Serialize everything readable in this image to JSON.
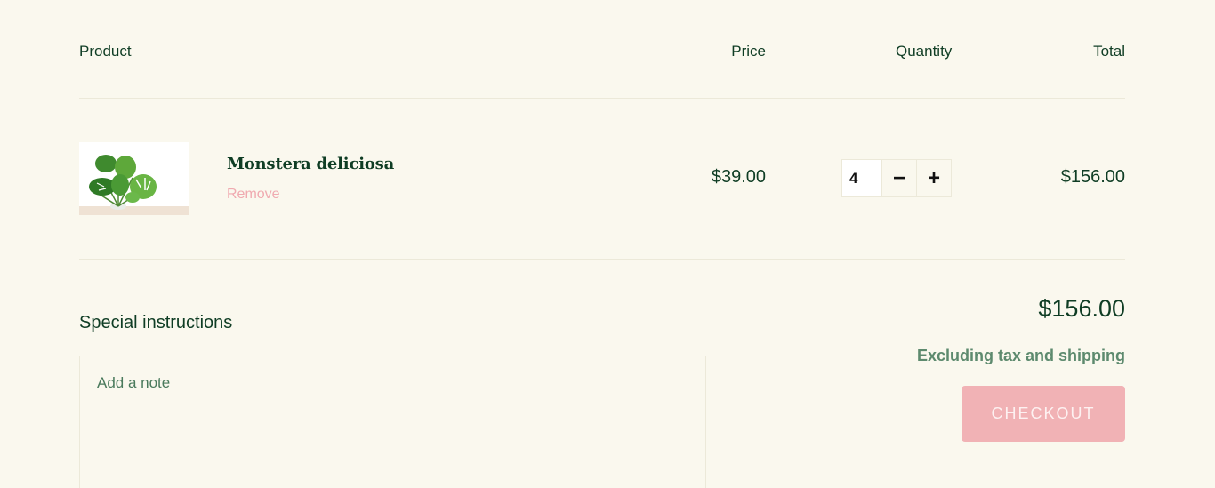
{
  "header": {
    "product": "Product",
    "price": "Price",
    "quantity": "Quantity",
    "total": "Total"
  },
  "item": {
    "name": "Monstera deliciosa",
    "remove_label": "Remove",
    "price": "$39.00",
    "quantity": "4",
    "decrement_symbol": "−",
    "increment_symbol": "+",
    "line_total": "$156.00",
    "image_icon": "monstera-plant-image"
  },
  "summary": {
    "special_instructions_label": "Special instructions",
    "note_placeholder": "Add a note",
    "subtotal": "$156.00",
    "tax_note": "Excluding tax and shipping",
    "checkout_label": "CHECKOUT"
  },
  "colors": {
    "background": "#faf8ee",
    "text_primary": "#0f3d24",
    "accent_pink": "#f1b2b5",
    "muted_green": "#5d8a6e"
  }
}
